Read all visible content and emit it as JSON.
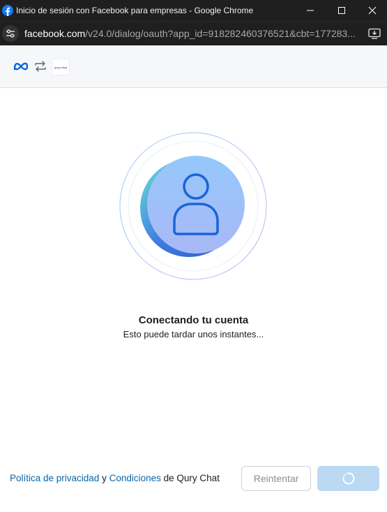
{
  "window": {
    "title": "Inicio de sesión con Facebook para empresas - Google Chrome"
  },
  "addressbar": {
    "domain": "facebook.com",
    "path": "/v24.0/dialog/oauth?app_id=918282460376521&cbt=177283..."
  },
  "header": {
    "app_logo_text": "qury chat"
  },
  "main": {
    "heading": "Conectando tu cuenta",
    "subtext": "Esto puede tardar unos instantes..."
  },
  "footer": {
    "privacy_link": "Política de privacidad",
    "conjunction": " y ",
    "terms_link": "Condiciones",
    "suffix": " de Qury Chat",
    "retry_label": "Reintentar"
  },
  "icons": {
    "browser_favicon": "facebook-icon",
    "site_info": "tune-icon",
    "install": "install-app-icon",
    "meta": "meta-logo-icon",
    "swap": "swap-arrows-icon",
    "avatar": "user-icon",
    "loading": "spinner-icon"
  },
  "colors": {
    "titlebar_bg": "#1f1f1f",
    "link": "#0a66a8",
    "primary_button_disabled": "#bcd9f3",
    "avatar_bg": "#9ccbfb",
    "avatar_stroke": "#1a64d6"
  }
}
